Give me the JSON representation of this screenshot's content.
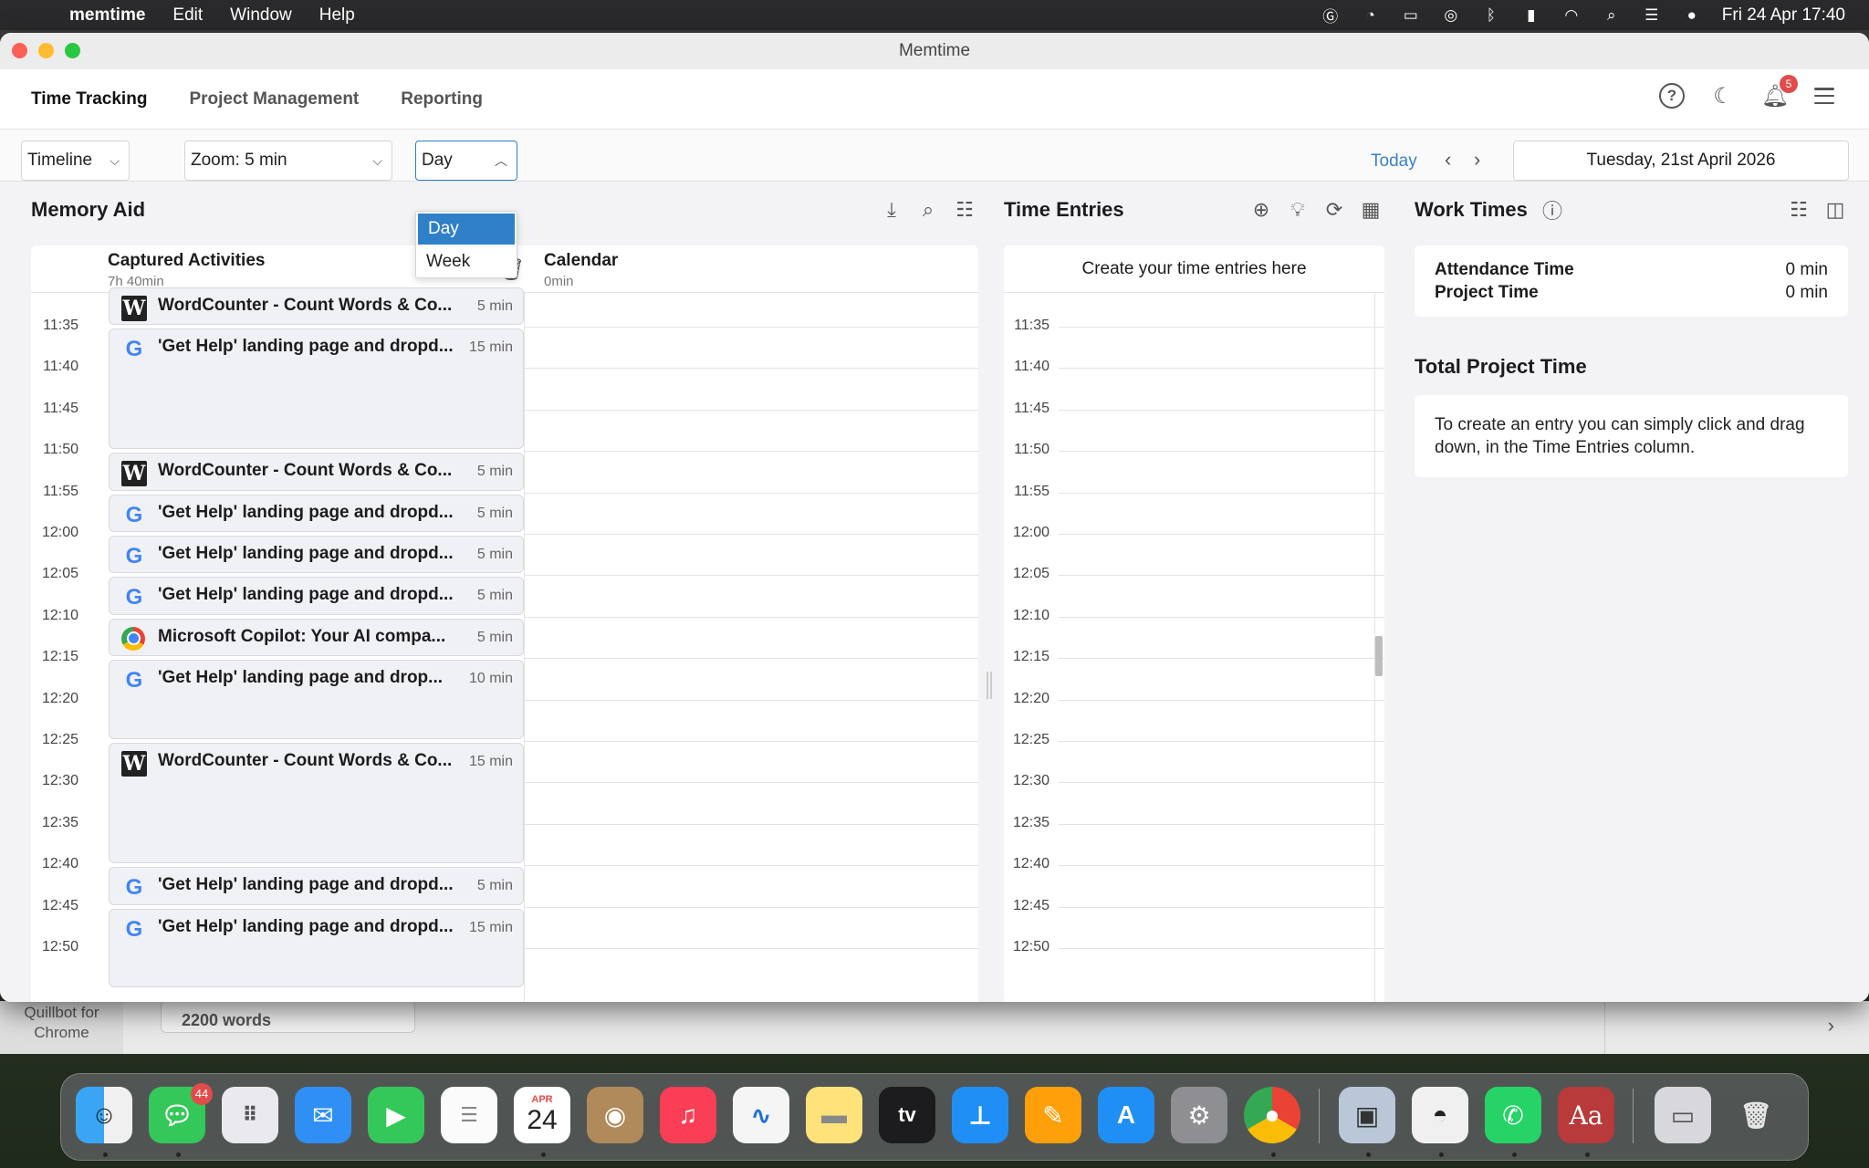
{
  "menubar": {
    "app": "memtime",
    "items": [
      "Edit",
      "Window",
      "Help"
    ],
    "clock": "Fri 24 Apr  17:40"
  },
  "window": {
    "title": "Memtime"
  },
  "nav": {
    "tabs": [
      "Time Tracking",
      "Project Management",
      "Reporting"
    ],
    "notifications": "5"
  },
  "toolbar": {
    "view": "Timeline",
    "zoom": "Zoom: 5 min",
    "range": "Day",
    "range_options": [
      "Day",
      "Week"
    ],
    "today": "Today",
    "date": "Tuesday, 21st April 2026"
  },
  "memory_aid": {
    "title": "Memory Aid",
    "captured_title": "Captured Activities",
    "captured_total": "7h 40min",
    "calendar_title": "Calendar",
    "calendar_total": "0min",
    "ticks": [
      "11:35",
      "11:40",
      "11:45",
      "11:50",
      "11:55",
      "12:00",
      "12:05",
      "12:10",
      "12:15",
      "12:20",
      "12:25",
      "12:30",
      "12:35",
      "12:40",
      "12:45",
      "12:50"
    ],
    "activities": [
      {
        "icon": "W",
        "title": "WordCounter - Count Words & Co...",
        "duration": "5 min"
      },
      {
        "icon": "G",
        "title": "'Get Help' landing page and dropd...",
        "duration": "15 min"
      },
      {
        "icon": "W",
        "title": "WordCounter - Count Words & Co...",
        "duration": "5 min"
      },
      {
        "icon": "G",
        "title": "'Get Help' landing page and dropd...",
        "duration": "5 min"
      },
      {
        "icon": "G",
        "title": "'Get Help' landing page and dropd...",
        "duration": "5 min"
      },
      {
        "icon": "G",
        "title": "'Get Help' landing page and dropd...",
        "duration": "5 min"
      },
      {
        "icon": "C",
        "title": "Microsoft Copilot: Your AI compa...",
        "duration": "5 min"
      },
      {
        "icon": "G",
        "title": "'Get Help' landing page and drop...",
        "duration": "10 min"
      },
      {
        "icon": "W",
        "title": "WordCounter - Count Words & Co...",
        "duration": "15 min"
      },
      {
        "icon": "G",
        "title": "'Get Help' landing page and dropd...",
        "duration": "5 min"
      },
      {
        "icon": "G",
        "title": "'Get Help' landing page and dropd...",
        "duration": "15 min"
      }
    ]
  },
  "time_entries": {
    "title": "Time Entries",
    "header": "Create your time entries here"
  },
  "work_times": {
    "title": "Work Times",
    "attendance_label": "Attendance Time",
    "attendance_value": "0 min",
    "project_label": "Project Time",
    "project_value": "0 min",
    "total_title": "Total Project Time",
    "hint": "To create an entry you can simply click and drag down, in the Time Entries column."
  },
  "background_window": {
    "sidebar_label": "Quillbot for Chrome",
    "card_text": "2200 words"
  },
  "dock": {
    "messages_badge": "44",
    "calendar_month": "APR",
    "calendar_day": "24"
  }
}
